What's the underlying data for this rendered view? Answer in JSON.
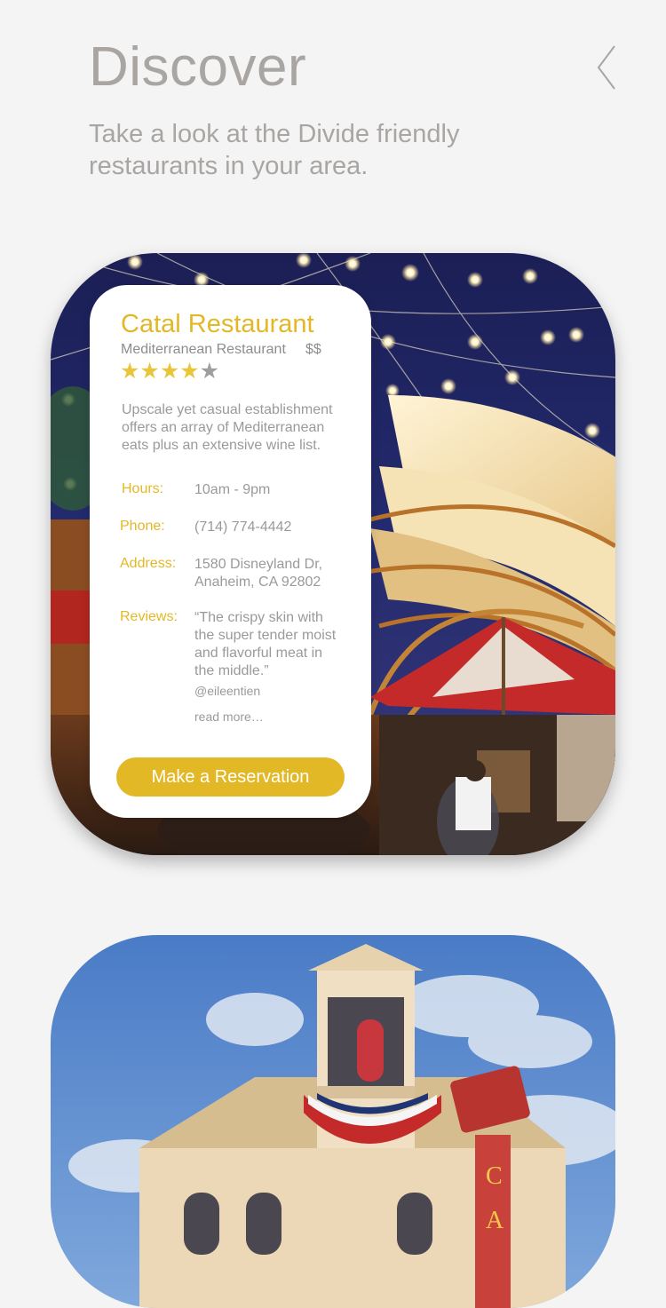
{
  "header": {
    "title": "Discover",
    "subtitle": "Take a look at the Divide friendly restaurants in your area."
  },
  "restaurant": {
    "name": "Catal Restaurant",
    "type": "Mediterranean Restaurant",
    "price": "$$",
    "rating": 4,
    "rating_max": 5,
    "stars_filled": "★★★★",
    "stars_empty": "★",
    "description": "Upscale yet casual establishment offers an array of Mediterranean eats plus an extensive wine list.",
    "hours_label": "Hours:",
    "hours": "10am - 9pm",
    "phone_label": "Phone:",
    "phone": "(714) 774-4442",
    "address_label": "Address:",
    "address_line1": "1580 Disneyland Dr,",
    "address_line2": "Anaheim, CA 92802",
    "reviews_label": "Reviews:",
    "review_text": "“The crispy skin with the super tender moist and flavorful meat in the middle.”",
    "review_author": "@eileentien",
    "read_more": "read more…",
    "reserve_label": "Make a Reservation"
  },
  "colors": {
    "accent": "#e3b826",
    "background": "#f4f4f4",
    "muted_text": "#a9a5a2"
  },
  "icons": {
    "back": "chevron-left-icon"
  }
}
